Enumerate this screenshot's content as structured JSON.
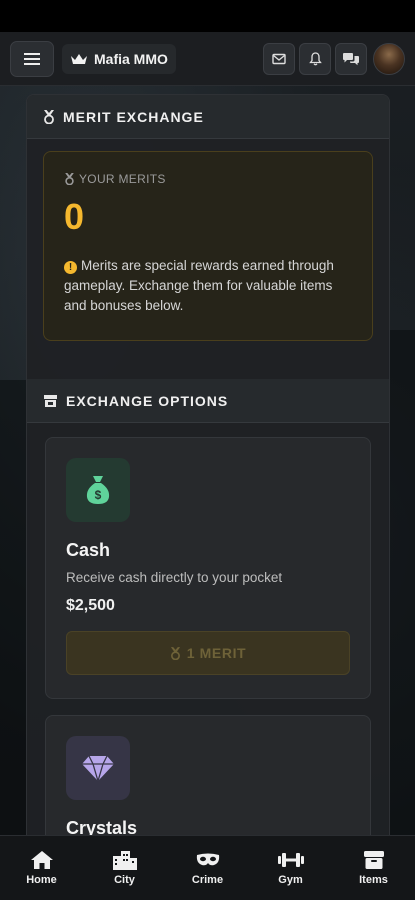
{
  "app": {
    "brand": "Mafia MMO"
  },
  "topbar": {
    "icons": [
      "menu-icon",
      "crown-icon",
      "mail-icon",
      "bell-icon",
      "chat-icon",
      "avatar"
    ]
  },
  "merit_exchange": {
    "title": "MERIT EXCHANGE",
    "your_merits_label": "YOUR MERITS",
    "merits_value": "0",
    "info_text": "Merits are special rewards earned through gameplay. Exchange them for valuable items and bonuses below."
  },
  "exchange_options": {
    "title": "EXCHANGE OPTIONS",
    "items": [
      {
        "title": "Cash",
        "description": "Receive cash directly to your pocket",
        "price": "$2,500",
        "button": "1 MERIT",
        "icon": "money-bag-icon"
      },
      {
        "title": "Crystals",
        "icon": "gem-icon"
      }
    ]
  },
  "nav": {
    "items": [
      {
        "label": "Home",
        "icon": "home-icon"
      },
      {
        "label": "City",
        "icon": "city-icon"
      },
      {
        "label": "Crime",
        "icon": "mask-icon"
      },
      {
        "label": "Gym",
        "icon": "dumbbell-icon"
      },
      {
        "label": "Items",
        "icon": "box-icon"
      }
    ]
  },
  "colors": {
    "accent": "#f5b82e",
    "cash_icon": "#5fd39a",
    "crystal_icon": "#b7a6ea"
  }
}
